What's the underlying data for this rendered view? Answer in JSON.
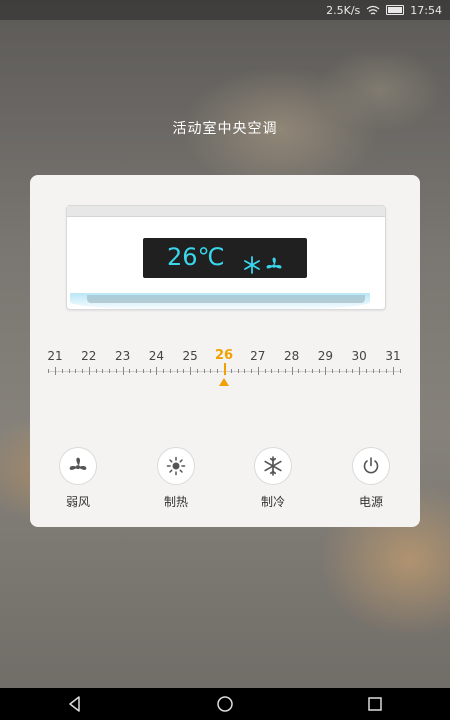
{
  "status_bar": {
    "network_speed": "2.5K/s",
    "time": "17:54"
  },
  "device_title": "活动室中央空调",
  "ac_display": {
    "temperature": "26℃",
    "icon_mode": "snowflake-icon",
    "icon_fan": "fan-icon",
    "text_color": "#39d6ec"
  },
  "temperature_scale": {
    "labels": [
      "21",
      "22",
      "23",
      "24",
      "25",
      "26",
      "27",
      "28",
      "29",
      "30",
      "31"
    ],
    "selected": "26",
    "accent_color": "#f0a000"
  },
  "controls": [
    {
      "id": "wind",
      "label": "弱风",
      "icon": "fan-icon"
    },
    {
      "id": "heat",
      "label": "制热",
      "icon": "sun-icon"
    },
    {
      "id": "cool",
      "label": "制冷",
      "icon": "snowflake-icon"
    },
    {
      "id": "power",
      "label": "电源",
      "icon": "power-icon"
    }
  ],
  "nav_bar": {
    "back": "back-icon",
    "home": "home-icon",
    "recent": "recent-apps-icon"
  }
}
